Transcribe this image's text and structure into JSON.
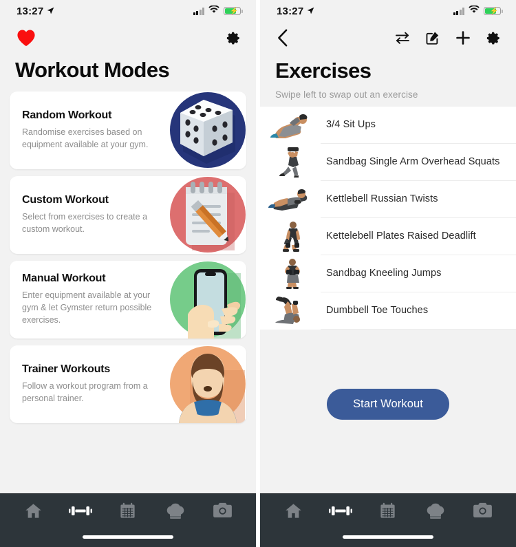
{
  "status_bar": {
    "time": "13:27",
    "location_icon": "location-arrow-icon",
    "signal_icon": "cellular-signal-icon",
    "wifi_icon": "wifi-icon",
    "battery_icon": "battery-charging-icon"
  },
  "left_screen": {
    "logo_icon": "heart-icon",
    "settings_icon": "gear-icon",
    "title": "Workout Modes",
    "cards": [
      {
        "title": "Random Workout",
        "description": "Randomise exercises based on equipment available at your gym.",
        "art": "dice-illustration",
        "color": "#26357a"
      },
      {
        "title": "Custom Workout",
        "description": "Select from exercises to create a custom workout.",
        "art": "notepad-pencil-illustration",
        "color": "#dd6f6f"
      },
      {
        "title": "Manual Workout",
        "description": "Enter equipment available at your gym & let Gymster return possible exercises.",
        "art": "hand-phone-illustration",
        "color": "#76cc8a"
      },
      {
        "title": "Trainer Workouts",
        "description": "Follow a workout program from a personal trainer.",
        "art": "trainer-avatar-illustration",
        "color": "#f0a875"
      }
    ]
  },
  "right_screen": {
    "back_icon": "chevron-left-icon",
    "actions": [
      {
        "icon": "swap-arrows-icon",
        "name": "swap-exercise-button"
      },
      {
        "icon": "edit-compose-icon",
        "name": "edit-button"
      },
      {
        "icon": "plus-icon",
        "name": "add-exercise-button"
      },
      {
        "icon": "gear-icon",
        "name": "settings-button"
      }
    ],
    "title": "Exercises",
    "subtitle": "Swipe left to swap out an exercise",
    "exercises": [
      {
        "name": "3/4 Sit Ups",
        "thumb": "sit-up-thumbnail"
      },
      {
        "name": "Sandbag Single Arm Overhead Squats",
        "thumb": "overhead-squat-thumbnail"
      },
      {
        "name": "Kettlebell Russian Twists",
        "thumb": "russian-twist-thumbnail"
      },
      {
        "name": "Kettelebell Plates Raised Deadlift",
        "thumb": "deadlift-thumbnail"
      },
      {
        "name": "Sandbag Kneeling Jumps",
        "thumb": "kneeling-jump-thumbnail"
      },
      {
        "name": "Dumbbell Toe Touches",
        "thumb": "toe-touch-thumbnail"
      }
    ],
    "start_button": "Start Workout",
    "start_button_color": "#3b5b99"
  },
  "tab_bar": {
    "background": "#2d353a",
    "items": [
      {
        "icon": "home-icon",
        "name": "tab-home",
        "active": false
      },
      {
        "icon": "dumbbell-icon",
        "name": "tab-workouts",
        "active": true
      },
      {
        "icon": "calendar-icon",
        "name": "tab-calendar",
        "active": false
      },
      {
        "icon": "chef-hat-icon",
        "name": "tab-nutrition",
        "active": false
      },
      {
        "icon": "camera-icon",
        "name": "tab-progress-photos",
        "active": false
      }
    ]
  }
}
